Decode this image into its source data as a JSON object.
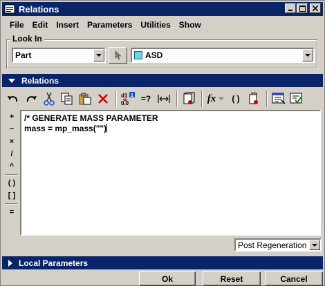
{
  "window": {
    "title": "Relations",
    "controls": [
      "_",
      "□",
      "×"
    ]
  },
  "menu": [
    "File",
    "Edit",
    "Insert",
    "Parameters",
    "Utilities",
    "Show"
  ],
  "look_in": {
    "label": "Look In",
    "type_value": "Part",
    "model_value": "ASD"
  },
  "relations_section": {
    "label": "Relations"
  },
  "toolbar": {
    "equals_q": "=?",
    "fx": "fx",
    "parens": "( )"
  },
  "operators": [
    "+",
    "−",
    "×",
    "/",
    "^",
    "( )",
    "[ ]",
    "="
  ],
  "editor": {
    "lines": [
      "/* GENERATE MASS PARAMETER",
      "mass = mp_mass(\"\")"
    ]
  },
  "regen_option": "Post Regeneration",
  "local_params_section": {
    "label": "Local Parameters"
  },
  "buttons": {
    "ok": "Ok",
    "reset": "Reset",
    "cancel": "Cancel"
  },
  "colors": {
    "title_bar": "#0a246a",
    "face": "#d4d0c8"
  }
}
